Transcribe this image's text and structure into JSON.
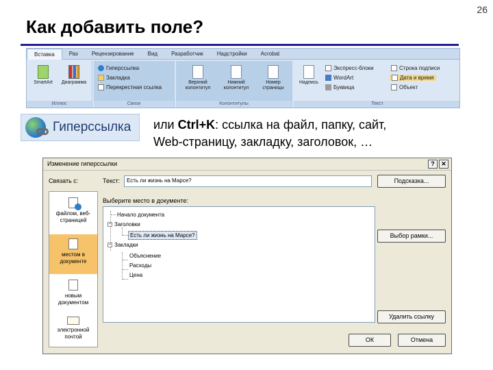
{
  "slide": {
    "number": "26",
    "title": "Как добавить поле?",
    "description_line1_prefix": "или ",
    "description_shortcut": "Ctrl+K",
    "description_line1_suffix": ": ссылка на файл, папку, сайт,",
    "description_line2": "Web-страницу, закладку, заголовок, …"
  },
  "ribbon": {
    "tabs": [
      "Вставка",
      "Раз",
      "Рецензирование",
      "Вид",
      "Разработчик",
      "Надстройки",
      "Acrobat"
    ],
    "left_labels": [
      "SmartArt",
      "Диаграмма"
    ],
    "links_group": {
      "items": [
        "Гиперссылка",
        "Закладка",
        "Перекрестная ссылка"
      ],
      "label": "Связи"
    },
    "header_group": {
      "items": [
        "Верхний колонтитул",
        "Нижний колонтитул",
        "Номер страницы"
      ],
      "label": "Колонтитулы"
    },
    "text_group": {
      "items": [
        "Надпись",
        "Экспресс-блоки",
        "WordArt",
        "Буквица",
        "Строка подписи",
        "Дата и время",
        "Объект"
      ],
      "label": "Текст"
    },
    "left_group_label": "Иллюс"
  },
  "hyperlink_button": {
    "label": "Гиперссылка"
  },
  "dialog": {
    "title": "Изменение гиперссылки",
    "help_button": "?",
    "close_button": "✕",
    "link_to_label": "Связать с:",
    "text_label": "Текст:",
    "text_value": "Есть ли жизнь на Марсе?",
    "screentip_button": "Подсказка...",
    "place_label": "Выберите место в документе:",
    "linkbar": [
      {
        "label": "файлом, веб-страницей",
        "icon": "web-page-icon"
      },
      {
        "label": "местом в документе",
        "icon": "document-place-icon",
        "selected": true
      },
      {
        "label": "новым документом",
        "icon": "new-document-icon"
      },
      {
        "label": "электронной почтой",
        "icon": "email-icon"
      }
    ],
    "tree": [
      {
        "label": "Начало документа",
        "level": 1
      },
      {
        "label": "Заголовки",
        "level": 1,
        "expander": "−"
      },
      {
        "label": "Есть ли жизнь на Марсе?",
        "level": 2,
        "selected": true
      },
      {
        "label": "Закладки",
        "level": 1,
        "expander": "−"
      },
      {
        "label": "Объяснение",
        "level": 2
      },
      {
        "label": "Расходы",
        "level": 2
      },
      {
        "label": "Цена",
        "level": 2
      }
    ],
    "frame_button": "Выбор рамки...",
    "remove_link_button": "Удалить ссылку",
    "ok_button": "ОК",
    "cancel_button": "Отмена"
  }
}
